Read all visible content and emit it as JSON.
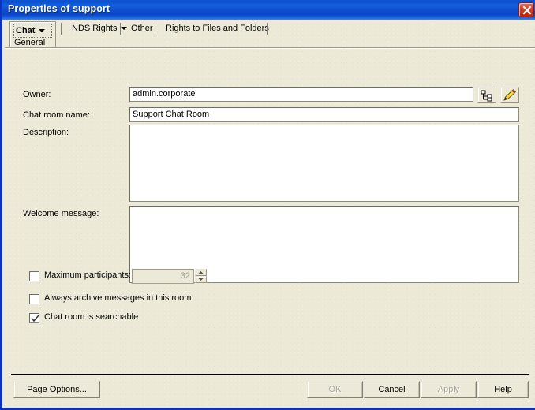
{
  "window": {
    "title": "Properties of support",
    "close_icon": "close-icon"
  },
  "tabs": [
    {
      "label": "Chat",
      "sublabel": "General",
      "has_caret": true,
      "selected": true
    },
    {
      "label": "NDS Rights",
      "has_caret": true,
      "selected": false
    },
    {
      "label": "Other",
      "has_caret": false,
      "selected": false
    },
    {
      "label": "Rights to Files and Folders",
      "has_caret": false,
      "selected": false
    }
  ],
  "form": {
    "owner": {
      "label": "Owner:",
      "value": "admin.corporate",
      "browse_icon": "object-selector-icon",
      "edit_icon": "pencil-icon"
    },
    "chat_room_name": {
      "label": "Chat room name:",
      "value": "Support Chat Room"
    },
    "description": {
      "label": "Description:",
      "value": ""
    },
    "welcome_message": {
      "label": "Welcome message:",
      "value": ""
    },
    "max_participants": {
      "label": "Maximum participants:",
      "checked": false,
      "value": "32",
      "enabled": false
    },
    "always_archive": {
      "label": "Always archive messages in this room",
      "checked": false
    },
    "searchable": {
      "label": "Chat room is searchable",
      "checked": true
    }
  },
  "buttons": {
    "page_options": "Page Options...",
    "ok": "OK",
    "cancel": "Cancel",
    "apply": "Apply",
    "help": "Help"
  },
  "colors": {
    "titlebar_blue": "#0d4fd0",
    "frame_blue": "#0a33c4",
    "dialog_face": "#ece9d8",
    "close_red": "#d6402a",
    "disabled_text": "#a8a496"
  }
}
